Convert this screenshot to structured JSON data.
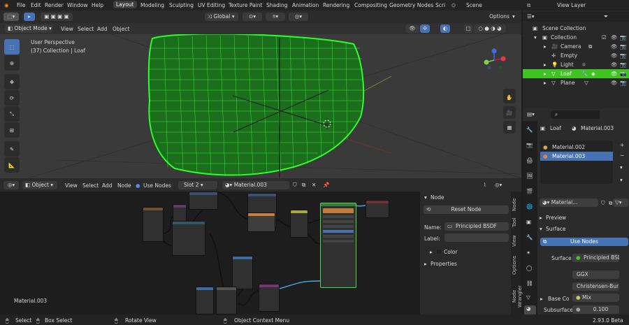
{
  "menu": {
    "file": "File",
    "edit": "Edit",
    "render": "Render",
    "window": "Window",
    "help": "Help"
  },
  "workspaces": [
    "Layout",
    "Modeling",
    "Sculpting",
    "UV Editing",
    "Texture Paint",
    "Shading",
    "Animation",
    "Rendering",
    "Compositing",
    "Geometry Nodes",
    "Scri"
  ],
  "scene": "Scene",
  "view_layer": "View Layer",
  "viewport": {
    "mode": "Object Mode",
    "menus": [
      "View",
      "Select",
      "Add",
      "Object"
    ],
    "transform": "Global",
    "options": "Options",
    "info_line1": "User Perspective",
    "info_line2": "(37) Collection | Loaf"
  },
  "node_editor": {
    "editor": "Object",
    "menus": [
      "View",
      "Select",
      "Add",
      "Node"
    ],
    "use_nodes": "Use Nodes",
    "slot": "Slot 2",
    "material": "Material.003",
    "material_label": "Material.003"
  },
  "sidebar": {
    "node_header": "Node",
    "reset_node": "Reset Node",
    "name_label": "Name:",
    "name_value": "Principled BSDF",
    "label_label": "Label:",
    "color": "Color",
    "properties": "Properties",
    "tabs": [
      "Node",
      "Tool",
      "View",
      "Options",
      "Node Wrangler"
    ]
  },
  "outliner": {
    "root": "Scene Collection",
    "items": [
      {
        "name": "Collection",
        "indent": 1
      },
      {
        "name": "Camera",
        "indent": 2
      },
      {
        "name": "Empty",
        "indent": 2
      },
      {
        "name": "Light",
        "indent": 2
      },
      {
        "name": "Loaf",
        "indent": 2,
        "selected": true
      },
      {
        "name": "Plane",
        "indent": 2
      }
    ]
  },
  "properties": {
    "object": "Loaf",
    "material": "Material.003",
    "slots": [
      "Material.002",
      "Material.003"
    ],
    "slot_selected": "Material.003",
    "mat_field": "Material...",
    "preview": "Preview",
    "surface_panel": "Surface",
    "use_nodes": "Use Nodes",
    "surface_label": "Surface",
    "surface_value": "Principled BSDF",
    "distribution": "GGX",
    "sss_method": "Christensen-Bur",
    "base_color_label": "Base Co",
    "base_color_value": "Mix",
    "subsurface_label": "Subsurface",
    "subsurface_value": "0.100"
  },
  "status": {
    "select": "Select",
    "box_select": "Box Select",
    "rotate_view": "Rotate View",
    "context_menu": "Object Context Menu",
    "version": "2.93.0 Beta"
  },
  "colors": {
    "accent": "#4772b3",
    "selected_row": "#3fc320",
    "wire": "#28ff28",
    "header": "#2b2b2b"
  }
}
